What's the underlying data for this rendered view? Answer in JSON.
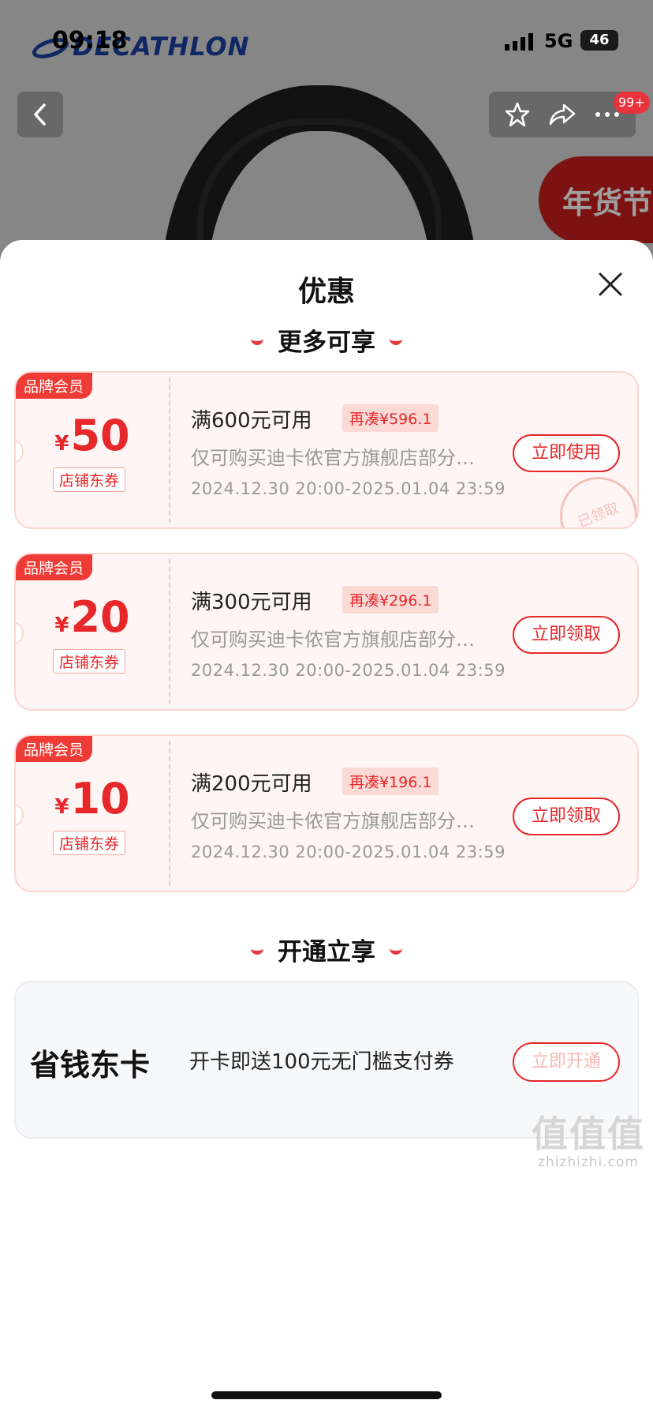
{
  "status_bar": {
    "time": "09:18",
    "network": "5G",
    "battery": "46"
  },
  "background": {
    "brand_logo": "DECATHLON",
    "promo_label": "年货节",
    "cart_badge": "99+"
  },
  "sheet": {
    "title": "优惠",
    "section_more": "更多可享",
    "section_open": "开通立享",
    "coupons": [
      {
        "badge": "品牌会员",
        "currency": "¥",
        "amount": "50",
        "tag": "店铺东券",
        "condition": "满600元可用",
        "gap": "再凑¥596.1",
        "scope": "仅可购买迪卡侬官方旗舰店部分…",
        "date": "2024.12.30 20:00-2025.01.04 23:59",
        "action": "立即使用",
        "stamp": "已领取"
      },
      {
        "badge": "品牌会员",
        "currency": "¥",
        "amount": "20",
        "tag": "店铺东券",
        "condition": "满300元可用",
        "gap": "再凑¥296.1",
        "scope": "仅可购买迪卡侬官方旗舰店部分…",
        "date": "2024.12.30 20:00-2025.01.04 23:59",
        "action": "立即领取"
      },
      {
        "badge": "品牌会员",
        "currency": "¥",
        "amount": "10",
        "tag": "店铺东券",
        "condition": "满200元可用",
        "gap": "再凑¥196.1",
        "scope": "仅可购买迪卡侬官方旗舰店部分…",
        "date": "2024.12.30 20:00-2025.01.04 23:59",
        "action": "立即领取"
      }
    ],
    "card": {
      "name": "省钱东卡",
      "desc": "开卡即送100元无门槛支付券",
      "action": "立即开通"
    }
  },
  "watermark": {
    "mark": "值值值",
    "site": "zhizhizhi.com"
  }
}
